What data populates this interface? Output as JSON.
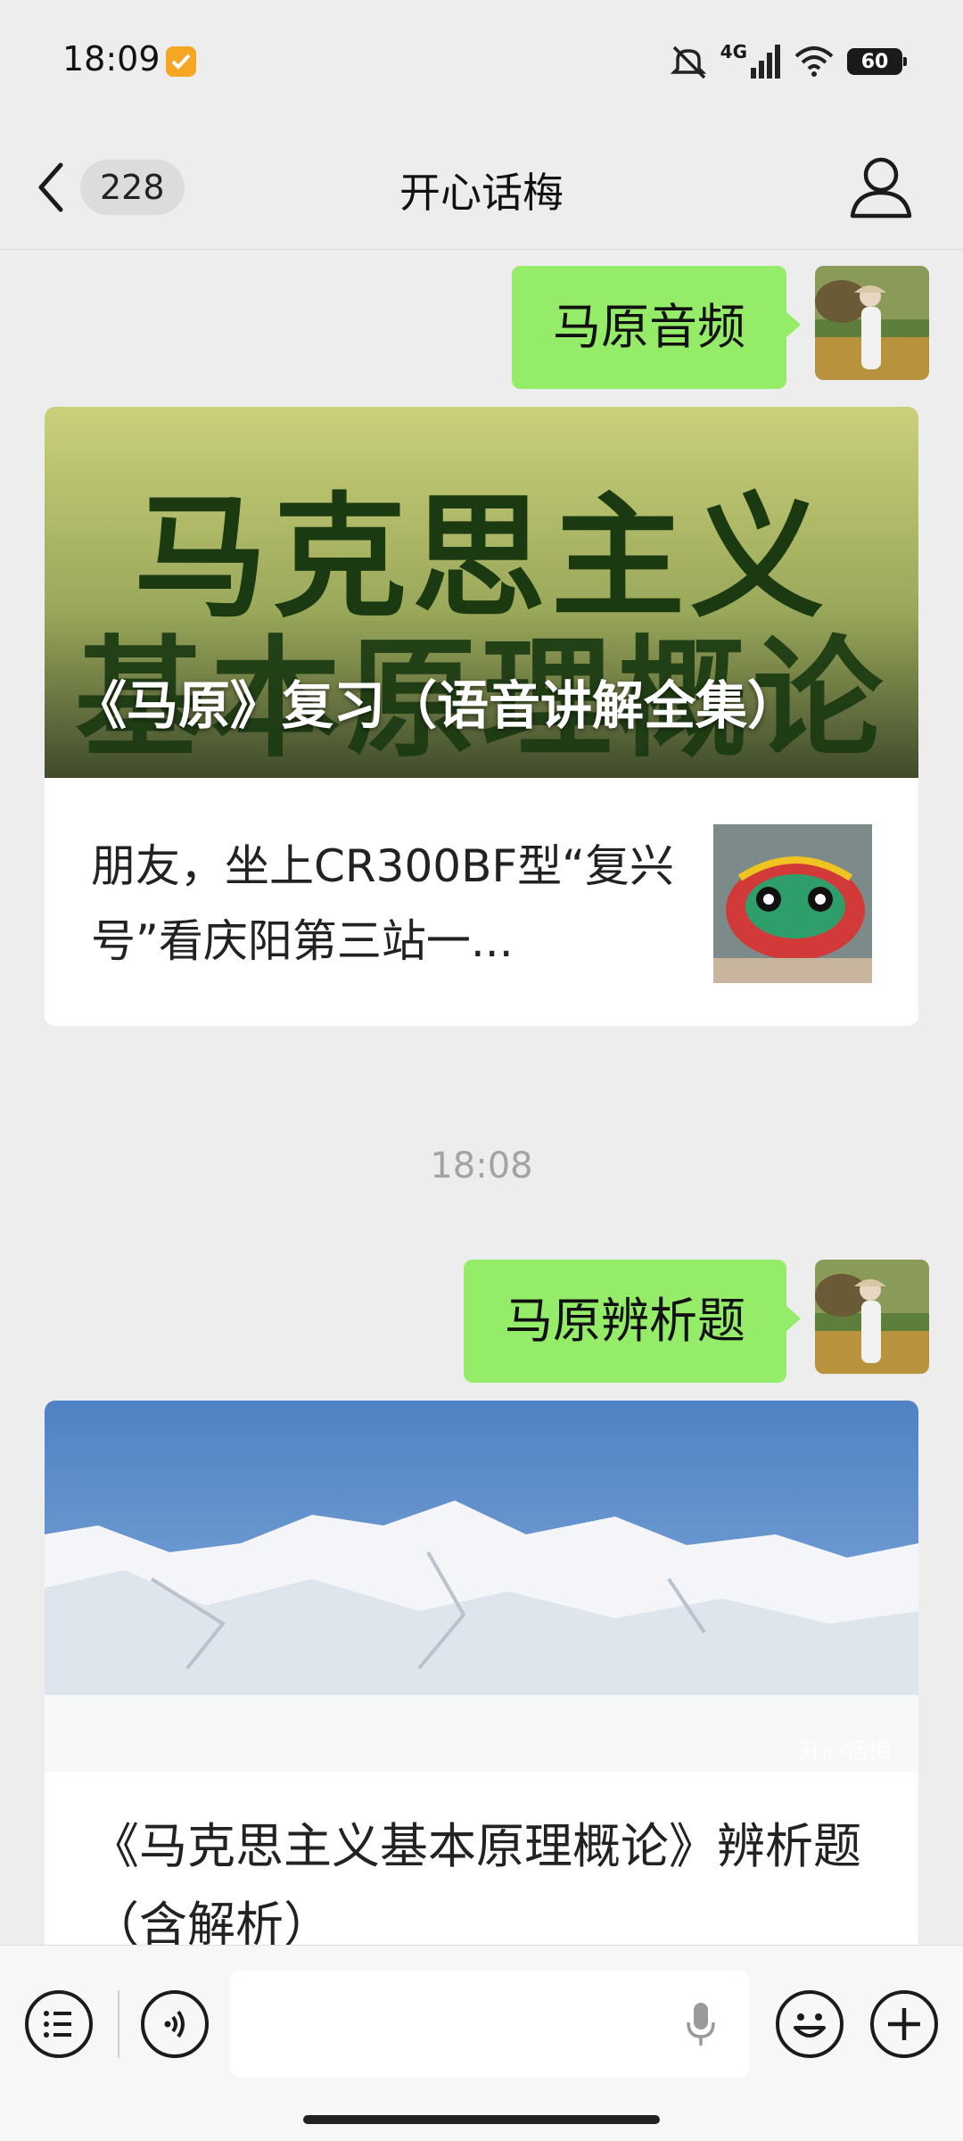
{
  "status_bar": {
    "time": "18:09",
    "network": "4G",
    "battery": "60"
  },
  "nav": {
    "unread_count": "228",
    "title": "开心话梅"
  },
  "messages": [
    {
      "text": "马原音频"
    },
    {
      "text": "马原辨析题"
    }
  ],
  "card1": {
    "cover_big_line1": "马克思主义",
    "cover_big_line2": "基本原理概论",
    "cover_title": "《马原》复习（语音讲解全集）",
    "sub_item_title": "朋友，坐上CR300BF型“复兴号”看庆阳第三站一..."
  },
  "timestamp": "18:08",
  "card2": {
    "watermark": "开心话梅",
    "title": "《马克思主义基本原理概论》辨析题（含解析）"
  },
  "icons": {
    "back": "chevron-left-icon",
    "profile": "person-icon",
    "list": "list-icon",
    "voice": "voice-icon",
    "mic": "microphone-icon",
    "emoji": "smile-icon",
    "plus": "plus-icon"
  },
  "colors": {
    "bubble": "#95ec69",
    "background": "#ededed"
  }
}
